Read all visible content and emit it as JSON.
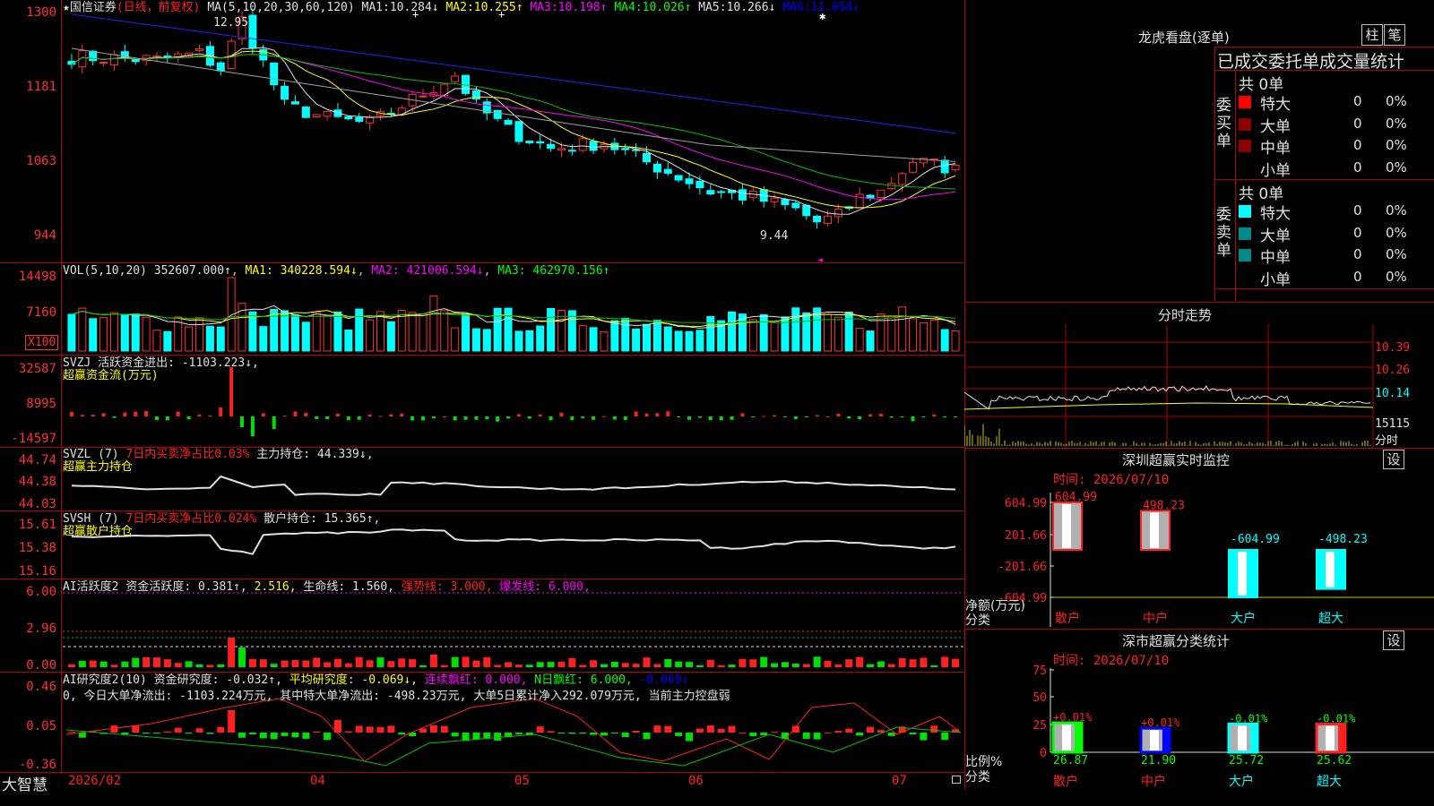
{
  "main": {
    "stock_name": "国信证券",
    "mode": "(日线，前复权)",
    "ma_header": "MA(5,10,20,30,60,120)",
    "ma": [
      {
        "label": "MA1:",
        "value": "10.284↓"
      },
      {
        "label": "MA2:",
        "value": "10.255↑"
      },
      {
        "label": "MA3:",
        "value": "10.198↑"
      },
      {
        "label": "MA4:",
        "value": "10.026↑"
      },
      {
        "label": "MA5:",
        "value": "10.266↓"
      },
      {
        "label": "MA6:",
        "value": "11.058↓"
      }
    ],
    "y_labels": [
      "1300",
      "1181",
      "1063",
      "944"
    ],
    "high_label": "12.95",
    "low_label": "9.44"
  },
  "vol": {
    "header": "VOL(5,10,20)",
    "value": "352607.000↑",
    "ma1": "MA1: 340228.594↓",
    "ma2": "MA2: 421006.594↓",
    "ma3": "MA3: 462970.156↑",
    "y_labels": [
      "14498",
      "7160"
    ],
    "unit": "X100"
  },
  "svzj": {
    "header": "SVZJ",
    "text": "活跃资金进出: -1103.223↓,",
    "sub": "超赢资金流(万元)",
    "y_labels": [
      "32587",
      "8995",
      "-14597"
    ]
  },
  "svzl": {
    "header": "SVZL (7)",
    "red": "7日内买卖净占比0.03%",
    "text": "主力持仓: 44.339↓,",
    "sub": "超赢主力持仓",
    "y_labels": [
      "44.74",
      "44.38",
      "44.03"
    ]
  },
  "svsh": {
    "header": "SVSH (7)",
    "red": "7日内买卖净占比0.024%",
    "text": "散户持仓: 15.365↑,",
    "sub": "超赢散户持仓",
    "y_labels": [
      "15.61",
      "15.38",
      "15.16"
    ]
  },
  "ai1": {
    "header": "AI活跃度2",
    "a": "资金活跃度: 0.381↑,",
    "b": "2.516,",
    "c": "生命线: 1.560,",
    "d": "强势线: 3.000,",
    "e": "爆发线: 6.000,",
    "y_labels": [
      "6.00",
      "2.96",
      "0.00"
    ]
  },
  "ai2": {
    "header": "AI研究度2(10)",
    "a": "资金研究度: -0.032↑,",
    "b": "平均研究度: -0.069↓,",
    "c": "连续飘红: 0.000,",
    "d": "N日飘红: 6.000,",
    "e": "-0.069↓",
    "line2": "0, 今日大单净流出: -1103.224万元, 其中特大单净流出: -498.23万元, 大单5日累计净入292.079万元, 当前主力控盘弱",
    "y_labels": [
      "0.46",
      "0.05",
      "-0.36"
    ]
  },
  "xaxis": {
    "app": "大智慧",
    "labels": [
      "2026/02",
      "04",
      "05",
      "06",
      "07"
    ]
  },
  "right": {
    "dragon_title": "龙虎看盘(逐单)",
    "btn1": "柱",
    "btn2": "笔",
    "stats_title": "已成交委托单成交量统计",
    "buy_label": "委买单",
    "sell_label": "委卖单",
    "buy_total": "共 0单",
    "sell_total": "共 0单",
    "buy_rows": [
      {
        "name": "特大",
        "count": "0",
        "pct": "0%"
      },
      {
        "name": "大单",
        "count": "0",
        "pct": "0%"
      },
      {
        "name": "中单",
        "count": "0",
        "pct": "0%"
      },
      {
        "name": "小单",
        "count": "0",
        "pct": "0%"
      }
    ],
    "sell_rows": [
      {
        "name": "特大",
        "count": "0",
        "pct": "0%"
      },
      {
        "name": "大单",
        "count": "0",
        "pct": "0%"
      },
      {
        "name": "中单",
        "count": "0",
        "pct": "0%"
      },
      {
        "name": "小单",
        "count": "0",
        "pct": "0%"
      }
    ],
    "buy_colors": [
      "#ff0000",
      "#8b0000",
      "#8b0000",
      "#000000"
    ],
    "sell_colors": [
      "#00ffff",
      "#008b8b",
      "#008b8b",
      "#000000"
    ],
    "intraday_title": "分时走势",
    "intraday_labels": [
      "10.39",
      "10.26",
      "10.14",
      "15115",
      "分时"
    ],
    "sz_title": "深圳超赢实时监控",
    "set": "设",
    "time_label": "时间: 2026/07/10",
    "sz_y": [
      "604.99",
      "201.66",
      "-201.66",
      "-604.99"
    ],
    "sz_unit": "净额(万元)",
    "sz_cat": "分类",
    "sz_bars": [
      {
        "name": "散户",
        "label": "604.99",
        "value": 604.99
      },
      {
        "name": "中户",
        "label": "498.23",
        "value": 498.23
      },
      {
        "name": "大户",
        "label": "-604.99",
        "value": -604.99
      },
      {
        "name": "超大",
        "label": "-498.23",
        "value": -498.23
      }
    ],
    "cls_title": "深市超赢分类统计",
    "cls_y": [
      "75",
      "50",
      "25",
      "0"
    ],
    "cls_unit": "比例%",
    "cls_cat": "分类",
    "cls_bars": [
      {
        "name": "散户",
        "top": "+0.01%",
        "bottom": "26.87",
        "value": 26.87,
        "color": "#00ff00"
      },
      {
        "name": "中户",
        "top": "+0.01%",
        "bottom": "21.90",
        "value": 21.9,
        "color": "#0000ff"
      },
      {
        "name": "大户",
        "top": "-0.01%",
        "bottom": "25.72",
        "value": 25.72,
        "color": "#00ffff"
      },
      {
        "name": "超大",
        "top": "-0.01%",
        "bottom": "25.62",
        "value": 25.62,
        "color": "#ff2020"
      }
    ]
  }
}
